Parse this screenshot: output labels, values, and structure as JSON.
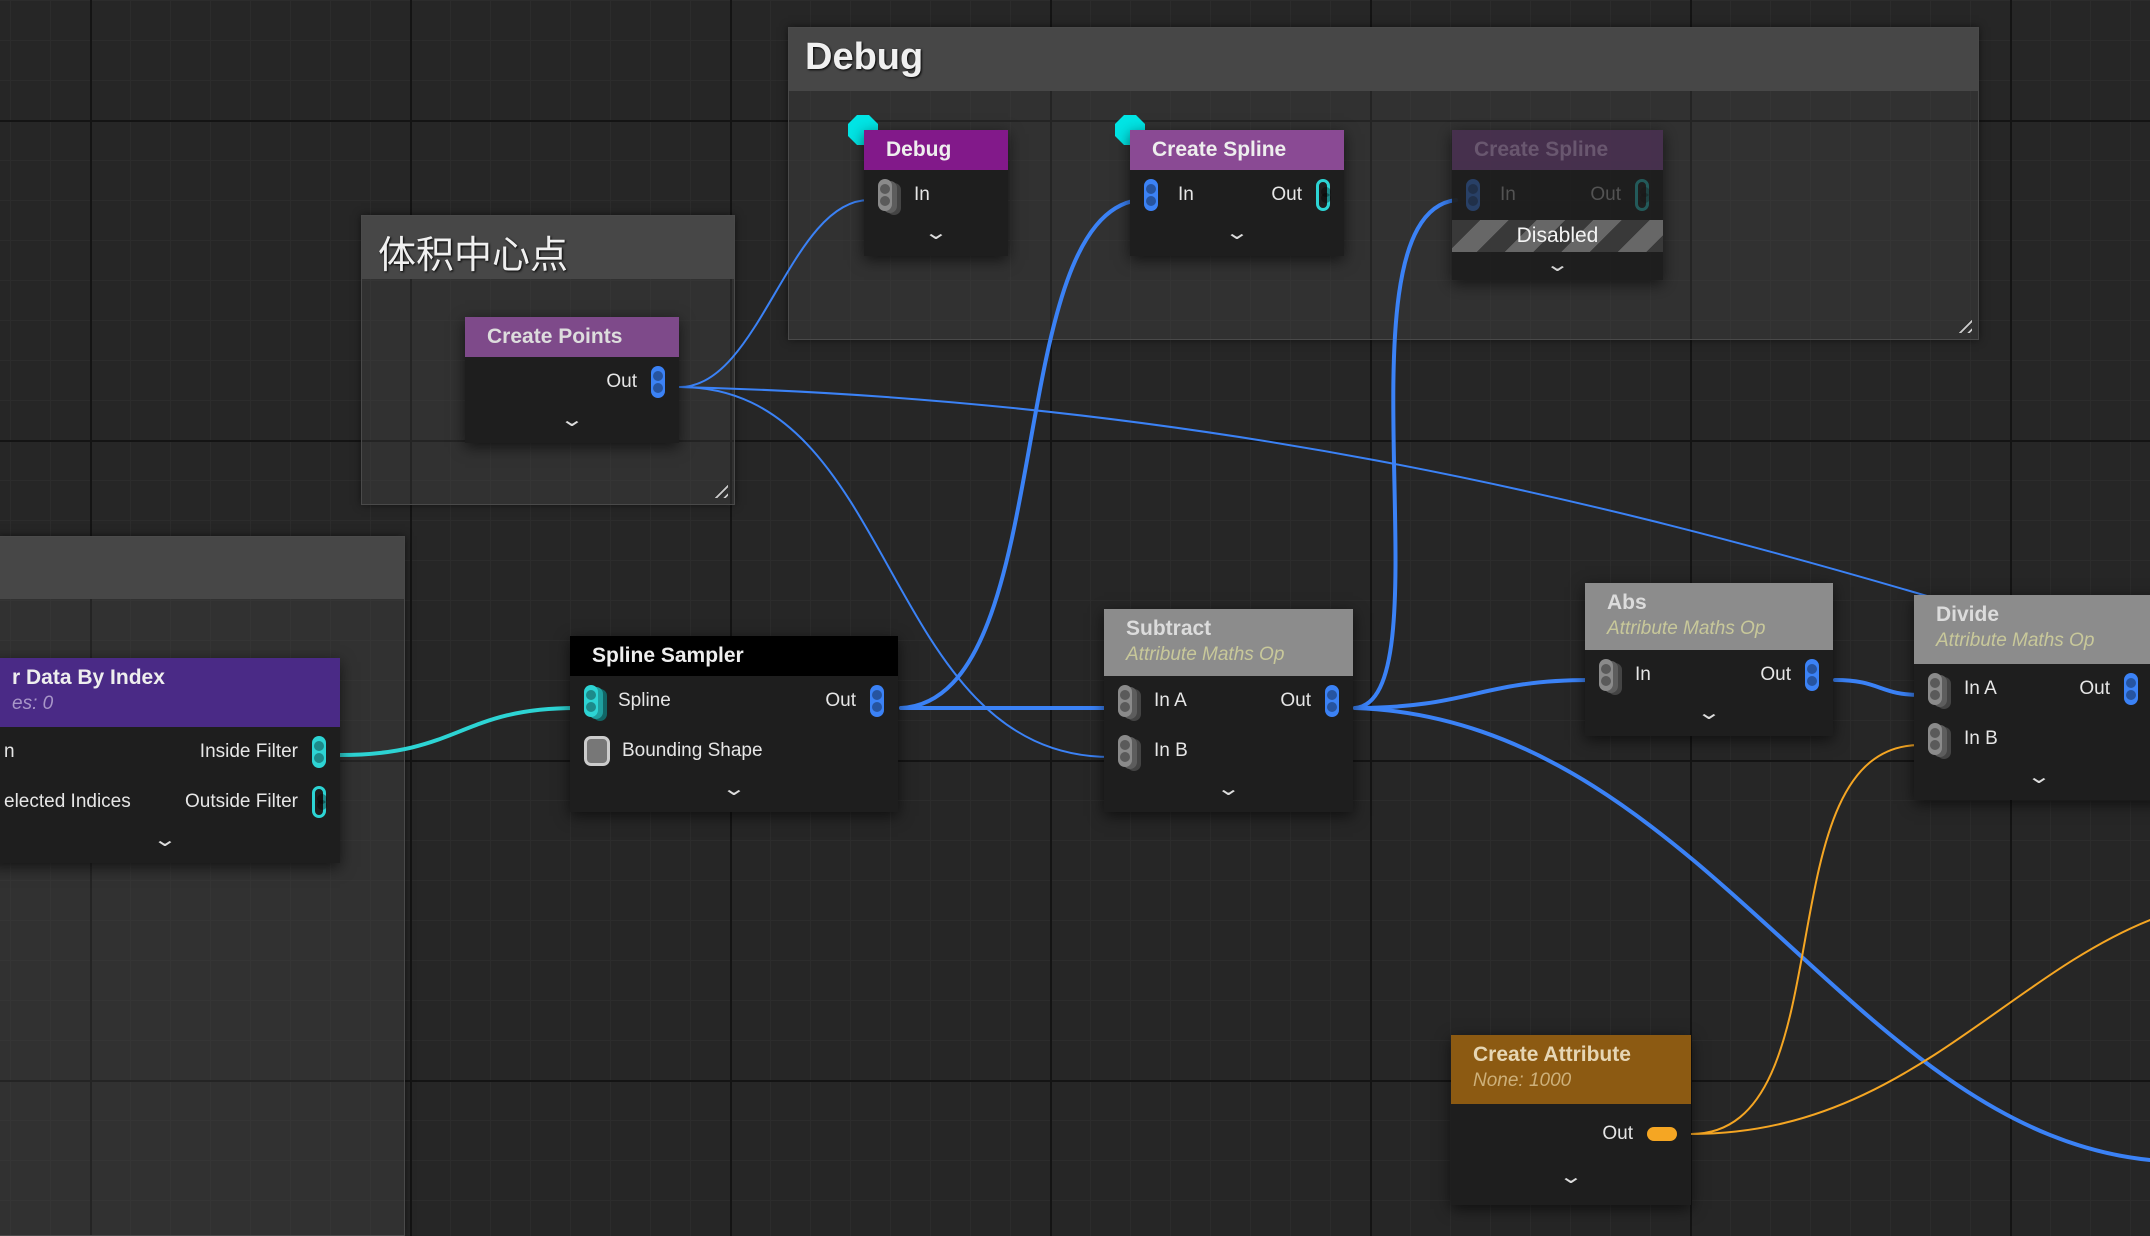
{
  "colors": {
    "wire_point": "#3b82f6",
    "wire_spline": "#2dd4d4",
    "wire_attribute": "#f5a623",
    "debug_marker": "#00e5e5"
  },
  "comments": {
    "debug": "Debug",
    "volume_center": "体积中心点",
    "left": ""
  },
  "nodes": {
    "debug": {
      "title": "Debug",
      "in": "In"
    },
    "create_spline": {
      "title": "Create Spline",
      "in": "In",
      "out": "Out"
    },
    "create_spline_disabled": {
      "title": "Create Spline",
      "in": "In",
      "out": "Out",
      "status": "Disabled"
    },
    "create_points": {
      "title": "Create Points",
      "out": "Out"
    },
    "filter": {
      "title": "r Data By Index",
      "subtitle": "es: 0",
      "in": "n",
      "in2": "elected Indices",
      "out1": "Inside Filter",
      "out2": "Outside Filter"
    },
    "spline_sampler": {
      "title": "Spline Sampler",
      "in1": "Spline",
      "in2": "Bounding Shape",
      "out": "Out"
    },
    "subtract": {
      "title": "Subtract",
      "subtitle": "Attribute Maths Op",
      "in_a": "In A",
      "in_b": "In B",
      "out": "Out"
    },
    "abs": {
      "title": "Abs",
      "subtitle": "Attribute Maths Op",
      "in": "In",
      "out": "Out"
    },
    "divide": {
      "title": "Divide",
      "subtitle": "Attribute Maths Op",
      "in_a": "In A",
      "in_b": "In B",
      "out": "Out"
    },
    "create_attribute": {
      "title": "Create Attribute",
      "subtitle": "None: 1000",
      "out": "Out"
    }
  }
}
